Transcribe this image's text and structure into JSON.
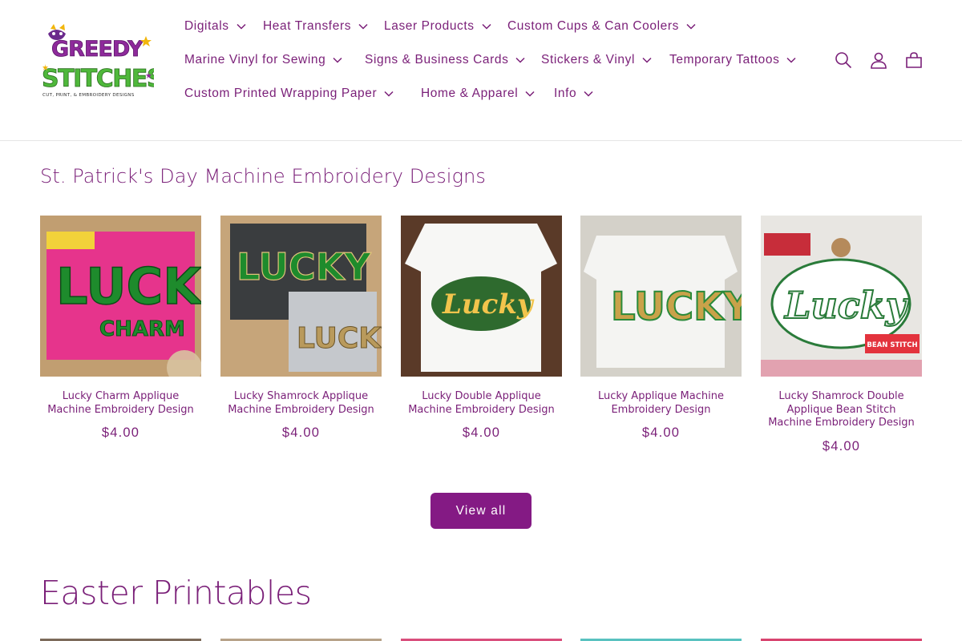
{
  "brand": {
    "logo_top": "GREEDY",
    "logo_bottom": "STITCHES",
    "logo_tagline": "CUT, PRINT, & EMBROIDERY DESIGNS"
  },
  "nav": {
    "row1": [
      {
        "label": "Digitals"
      },
      {
        "label": "Heat Transfers"
      },
      {
        "label": "Laser Products"
      },
      {
        "label": "Custom Cups & Can Coolers"
      }
    ],
    "row2": [
      {
        "label": "Marine Vinyl for Sewing"
      },
      {
        "label": "Signs & Business Cards"
      },
      {
        "label": "Stickers & Vinyl"
      },
      {
        "label": "Temporary Tattoos"
      }
    ],
    "row3": [
      {
        "label": "Custom Printed Wrapping Paper"
      },
      {
        "label": "Home & Apparel"
      },
      {
        "label": "Info"
      }
    ]
  },
  "header_icons": [
    "search-icon",
    "account-icon",
    "cart-icon"
  ],
  "section1": {
    "title": "St. Patrick's Day Machine Embroidery Designs",
    "products": [
      {
        "title": "Lucky Charm Applique Machine Embroidery Design",
        "price": "$4.00",
        "image_text": "LUCKY",
        "image_text2": "CHARM"
      },
      {
        "title": "Lucky Shamrock Applique Machine Embroidery Design",
        "price": "$4.00",
        "image_text": "LUCKY"
      },
      {
        "title": "Lucky Double Applique Machine Embroidery Design",
        "price": "$4.00",
        "image_text": "Lucky"
      },
      {
        "title": "Lucky Applique Machine Embroidery Design",
        "price": "$4.00",
        "image_text": "LUCKY"
      },
      {
        "title": "Lucky Shamrock Double Applique Bean Stitch Machine Embroidery Design",
        "price": "$4.00",
        "image_text": "Lucky",
        "badge": "BEAN STITCH"
      }
    ],
    "view_all_label": "View all"
  },
  "section2": {
    "title": "Easter Printables"
  },
  "colors": {
    "brand_purple": "#7a1f78",
    "button_purple": "#841a84"
  }
}
